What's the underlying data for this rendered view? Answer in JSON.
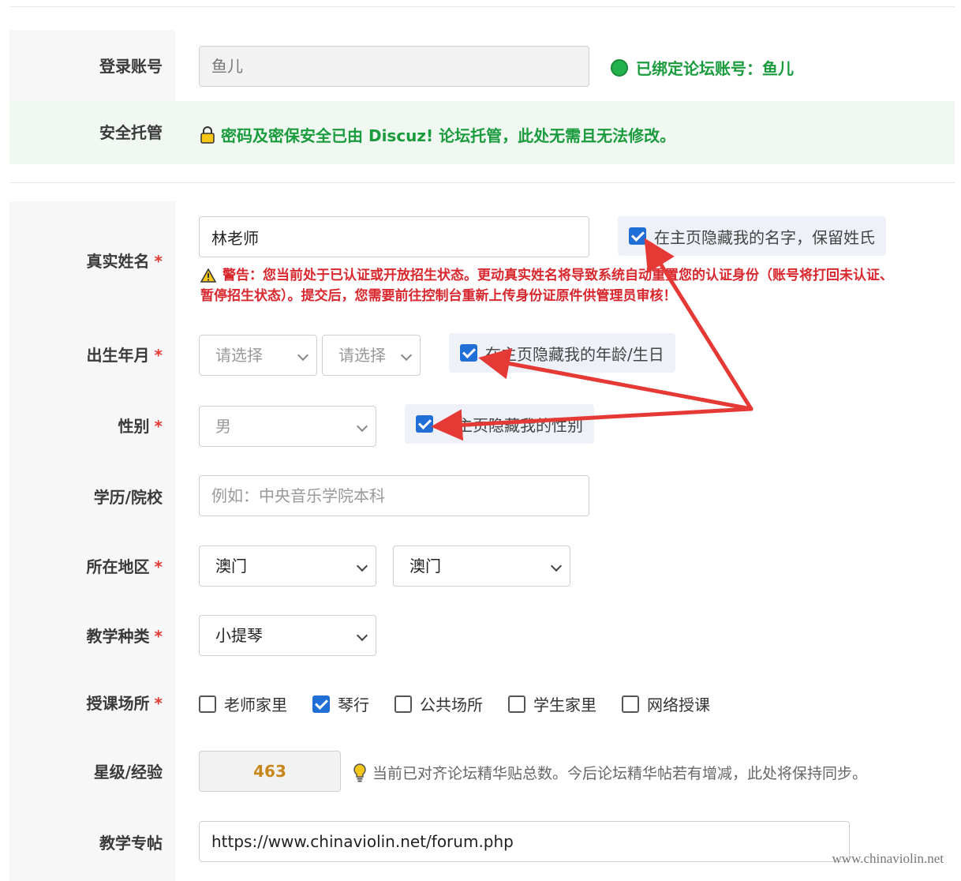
{
  "account": {
    "label": "登录账号",
    "value": "鱼儿",
    "bound_text": "已绑定论坛账号：鱼儿"
  },
  "security": {
    "label": "安全托管",
    "text": "密码及密保安全已由 Discuz! 论坛托管，此处无需且无法修改。"
  },
  "real_name": {
    "label": "真实姓名",
    "required_mark": "*",
    "value": "林老师",
    "hide_option": "在主页隐藏我的名字，保留姓氏",
    "hide_checked": true,
    "warning_line1": "警告：您当前处于已认证或开放招生状态。更动真实姓名将导致系统自动重置您的认证身份（账号将打回未认证、",
    "warning_line2": "暂停招生状态）。提交后，您需要前往控制台重新上传身份证原件供管理员审核！"
  },
  "birth": {
    "label": "出生年月",
    "required_mark": "*",
    "year_value": "请选择",
    "month_value": "请选择",
    "hide_option": "在主页隐藏我的年龄/生日",
    "hide_checked": true
  },
  "gender": {
    "label": "性别",
    "required_mark": "*",
    "value": "男",
    "hide_option": "在主页隐藏我的性别",
    "hide_checked": true
  },
  "education": {
    "label": "学历/院校",
    "placeholder": "例如：中央音乐学院本科"
  },
  "region": {
    "label": "所在地区",
    "required_mark": "*",
    "province": "澳门",
    "city": "澳门"
  },
  "teaching_type": {
    "label": "教学种类",
    "required_mark": "*",
    "value": "小提琴"
  },
  "venue": {
    "label": "授课场所",
    "required_mark": "*",
    "options": [
      {
        "label": "老师家里",
        "checked": false
      },
      {
        "label": "琴行",
        "checked": true
      },
      {
        "label": "公共场所",
        "checked": false
      },
      {
        "label": "学生家里",
        "checked": false
      },
      {
        "label": "网络授课",
        "checked": false
      }
    ]
  },
  "level": {
    "label": "星级/经验",
    "value": "463",
    "hint": "当前已对齐论坛精华贴总数。今后论坛精华帖若有增减，此处将保持同步。"
  },
  "post": {
    "label": "教学专帖",
    "value": "https://www.chinaviolin.net/forum.php"
  },
  "watermark": "www.chinaviolin.net",
  "colors": {
    "green": "#1a9b3d",
    "warning_red": "#d9272e",
    "checkbox_blue": "#1f6fd6",
    "arrow_red": "#e53935",
    "level_orange": "#c8871a"
  }
}
